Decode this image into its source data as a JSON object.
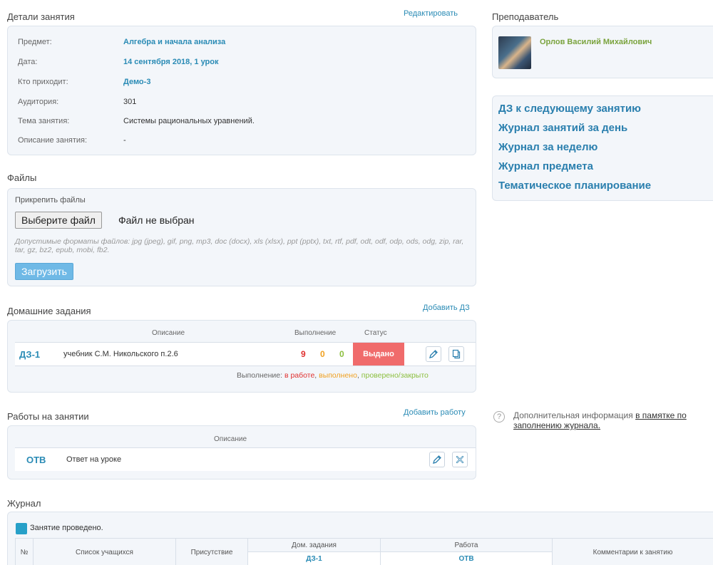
{
  "details": {
    "title": "Детали занятия",
    "edit_link": "Редактировать",
    "rows": [
      {
        "label": "Предмет:",
        "value": "Алгебра и начала анализа"
      },
      {
        "label": "Дата:",
        "value": "14 сентября 2018, 1 урок"
      },
      {
        "label": "Кто приходит:",
        "value": "Демо-3"
      },
      {
        "label": "Аудитория:",
        "value": "301"
      },
      {
        "label": "Тема занятия:",
        "value": "Системы рациональных уравнений."
      },
      {
        "label": "Описание занятия:",
        "value": "-"
      }
    ]
  },
  "teacher": {
    "title": "Преподаватель",
    "name": "Орлов Василий Михайлович"
  },
  "quick_links": [
    "ДЗ к следующему занятию",
    "Журнал занятий за день",
    "Журнал за неделю",
    "Журнал предмета",
    "Тематическое планирование"
  ],
  "files": {
    "title": "Файлы",
    "attach_label": "Прикрепить файлы",
    "choose_button": "Выберите файл",
    "no_file": "Файл не выбран",
    "formats": "Допустимые форматы файлов: jpg (jpeg), gif, png, mp3, doc (docx), xls (xlsx), ppt (pptx), txt, rtf, pdf, odt, odf, odp, ods, odg, zip, rar, tar, gz, bz2, epub, mobi, fb2.",
    "upload_button": "Загрузить"
  },
  "homework": {
    "title": "Домашние задания",
    "add_link": "Добавить ДЗ",
    "headers": {
      "description": "Описание",
      "completion": "Выполнение",
      "status": "Статус"
    },
    "rows": [
      {
        "code": "ДЗ-1",
        "description": "учебник С.М. Никольского п.2.6",
        "in_work": "9",
        "done": "0",
        "checked": "0",
        "status": "Выдано"
      }
    ],
    "legend": {
      "prefix": "Выполнение:",
      "in_work": "в работе",
      "done": "выполнено",
      "checked": "проверено/закрыто"
    },
    "colors": {
      "in_work": "#e0302f",
      "done": "#f0a020",
      "checked": "#8cbf3f",
      "status_bg": "#f06b6b"
    }
  },
  "classwork": {
    "title": "Работы на занятии",
    "add_link": "Добавить работу",
    "headers": {
      "description": "Описание"
    },
    "rows": [
      {
        "code": "ОТВ",
        "description": "Ответ на уроке"
      }
    ]
  },
  "help": {
    "text": "Дополнительная информация",
    "link": "в памятке по заполнению журнала."
  },
  "journal": {
    "title": "Журнал",
    "legend": "Занятие проведено.",
    "headers": {
      "num": "№",
      "students": "Список учащихся",
      "presence": "Присутствие",
      "homework": "Дом. задания",
      "work": "Работа",
      "comments": "Комментарии к занятию"
    },
    "sub_headers": {
      "homework": "ДЗ-1",
      "work": "ОТВ"
    }
  }
}
